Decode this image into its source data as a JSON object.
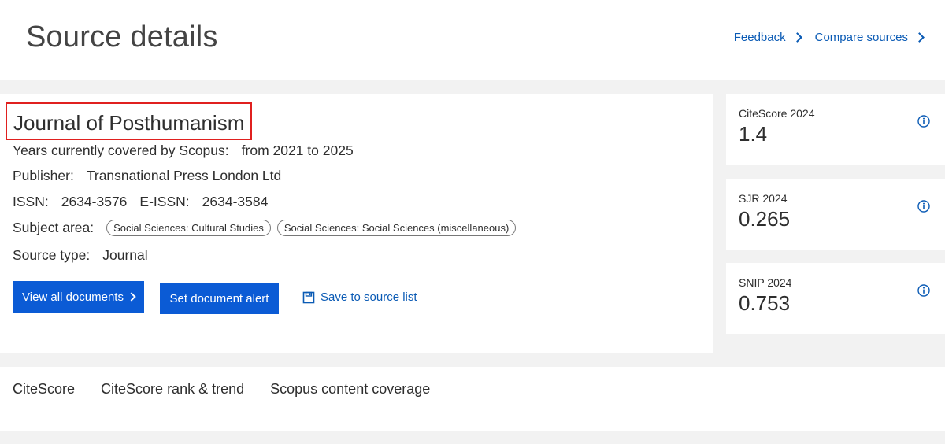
{
  "header": {
    "title": "Source details",
    "links": [
      {
        "label": "Feedback"
      },
      {
        "label": "Compare sources"
      }
    ]
  },
  "journal": {
    "title": "Journal of Posthumanism",
    "years_label": "Years currently covered by Scopus:",
    "years_value": "from 2021 to 2025",
    "publisher_label": "Publisher:",
    "publisher_value": "Transnational Press London Ltd",
    "issn_label": "ISSN:",
    "issn_value": "2634-3576",
    "eissn_label": "E-ISSN:",
    "eissn_value": "2634-3584",
    "subject_label": "Subject area:",
    "subjects": [
      "Social Sciences: Cultural Studies",
      "Social Sciences: Social Sciences (miscellaneous)"
    ],
    "type_label": "Source type:",
    "type_value": "Journal"
  },
  "actions": {
    "view_all": "View all documents",
    "set_alert": "Set document alert",
    "save_list": "Save to source list"
  },
  "metrics": {
    "citescore": {
      "label": "CiteScore 2024",
      "value": "1.4"
    },
    "sjr": {
      "label": "SJR 2024",
      "value": "0.265"
    },
    "snip": {
      "label": "SNIP 2024",
      "value": "0.753"
    }
  },
  "tabs": [
    {
      "label": "CiteScore"
    },
    {
      "label": "CiteScore rank & trend"
    },
    {
      "label": "Scopus content coverage"
    }
  ],
  "colors": {
    "accent": "#0b5bd5",
    "link": "#0b5bb5",
    "highlight_box": "#e0201f",
    "background": "#f2f2f2"
  },
  "icons": [
    "chevron-right-icon",
    "save-icon",
    "info-icon"
  ]
}
